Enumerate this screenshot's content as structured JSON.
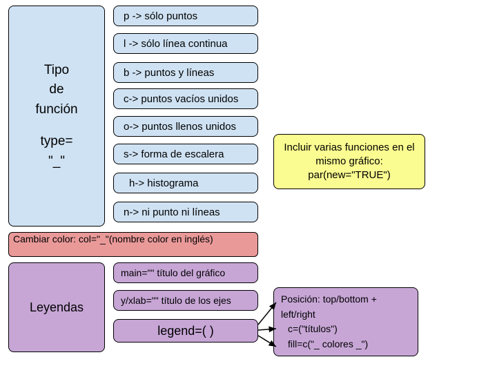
{
  "type_block": {
    "title_line1": "Tipo",
    "title_line2": "de",
    "title_line3": "función",
    "subtitle_line1": "type=",
    "subtitle_line2": "\"_\"",
    "items": [
      "p -> sólo puntos",
      "l -> sólo línea continua",
      "b -> puntos y líneas",
      "c-> puntos vacíos unidos",
      "o-> puntos llenos unidos",
      "s-> forma de escalera",
      "h-> histograma",
      "n-> ni punto ni líneas"
    ]
  },
  "color_row": "Cambiar color: col=\"_\"(nombre color en inglés)",
  "legend_block": {
    "title": "Leyendas",
    "items": [
      "main=\"\"  título del gráfico",
      "y/xlab=\"\" título de los ejes"
    ],
    "command": "legend=( )"
  },
  "yellow_note": {
    "line1": "Incluir varias funciones en el",
    "line2": "mismo gráfico:",
    "line3": "par(new=\"TRUE\")"
  },
  "legend_pos": {
    "line1": "Posición: top/bottom +",
    "line2": "left/right",
    "line3": "c=(\"títulos\")",
    "line4": "fill=c(\"_ colores _\")"
  }
}
